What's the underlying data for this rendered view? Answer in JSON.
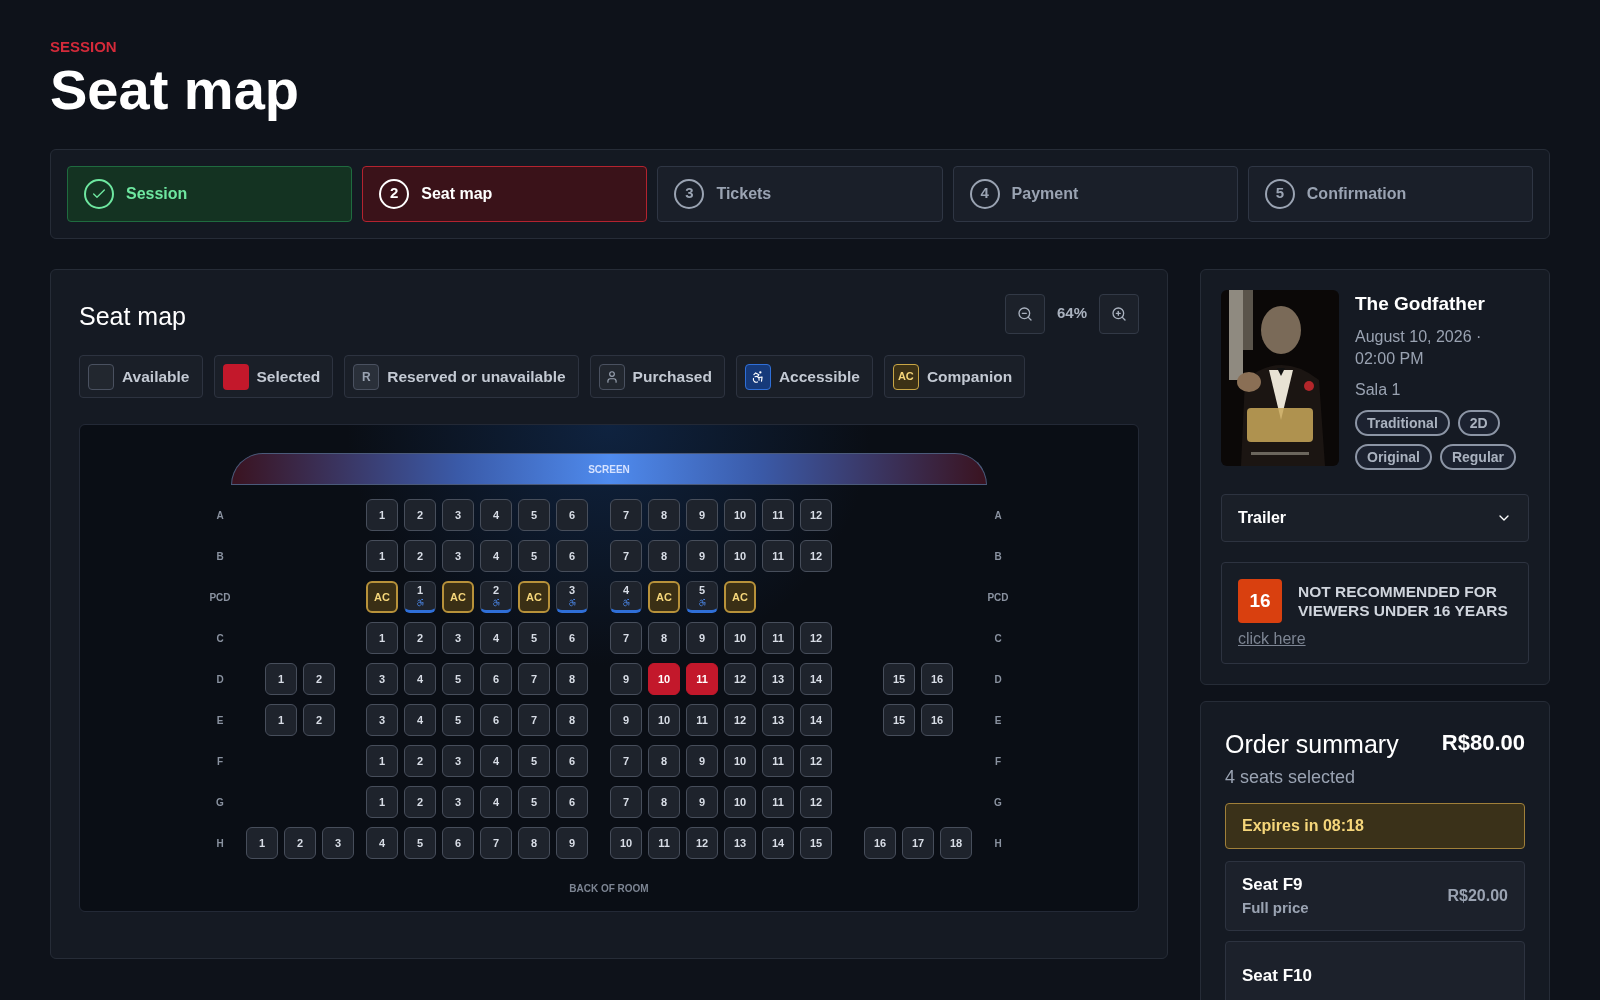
{
  "header": {
    "eyebrow": "SESSION",
    "title": "Seat map"
  },
  "steps": [
    {
      "label": "Session",
      "done": true,
      "selected": false
    },
    {
      "number": "2",
      "label": "Seat map",
      "done": false,
      "selected": true
    },
    {
      "number": "3",
      "label": "Tickets",
      "done": false,
      "selected": false
    },
    {
      "number": "4",
      "label": "Payment",
      "done": false,
      "selected": false
    },
    {
      "number": "5",
      "label": "Confirmation",
      "done": false,
      "selected": false
    }
  ],
  "seat_map": {
    "title": "Seat map",
    "zoom": "64%",
    "legend": [
      {
        "kind": "available",
        "label": "Available"
      },
      {
        "kind": "selected",
        "label": "Selected"
      },
      {
        "kind": "reserved",
        "symbol": "R",
        "label": "Reserved or unavailable"
      },
      {
        "kind": "purchased",
        "label": "Purchased"
      },
      {
        "kind": "accessible",
        "label": "Accessible"
      },
      {
        "kind": "companion",
        "symbol": "AC",
        "label": "Companion"
      }
    ],
    "screen_label": "SCREEN",
    "back_label": "BACK OF ROOM",
    "rows": [
      {
        "label_left": "A",
        "label_right": "A",
        "center_left": [
          {
            "label": "1",
            "kind": "standard",
            "selected": false
          },
          {
            "label": "2",
            "kind": "standard",
            "selected": false
          },
          {
            "label": "3",
            "kind": "standard",
            "selected": false
          },
          {
            "label": "4",
            "kind": "standard",
            "selected": false
          },
          {
            "label": "5",
            "kind": "standard",
            "selected": false
          },
          {
            "label": "6",
            "kind": "standard",
            "selected": false
          }
        ],
        "center_right": [
          {
            "label": "7",
            "kind": "standard",
            "selected": false
          },
          {
            "label": "8",
            "kind": "standard",
            "selected": false
          },
          {
            "label": "9",
            "kind": "standard",
            "selected": false
          },
          {
            "label": "10",
            "kind": "standard",
            "selected": false
          },
          {
            "label": "11",
            "kind": "standard",
            "selected": false
          },
          {
            "label": "12",
            "kind": "standard",
            "selected": false
          }
        ]
      },
      {
        "label_left": "B",
        "label_right": "B",
        "center_left": [
          {
            "label": "1",
            "kind": "standard",
            "selected": false
          },
          {
            "label": "2",
            "kind": "standard",
            "selected": false
          },
          {
            "label": "3",
            "kind": "standard",
            "selected": false
          },
          {
            "label": "4",
            "kind": "standard",
            "selected": false
          },
          {
            "label": "5",
            "kind": "standard",
            "selected": false
          },
          {
            "label": "6",
            "kind": "standard",
            "selected": false
          }
        ],
        "center_right": [
          {
            "label": "7",
            "kind": "standard",
            "selected": false
          },
          {
            "label": "8",
            "kind": "standard",
            "selected": false
          },
          {
            "label": "9",
            "kind": "standard",
            "selected": false
          },
          {
            "label": "10",
            "kind": "standard",
            "selected": false
          },
          {
            "label": "11",
            "kind": "standard",
            "selected": false
          },
          {
            "label": "12",
            "kind": "standard",
            "selected": false
          }
        ]
      },
      {
        "label_left": "PCD",
        "label_right": "PCD",
        "center_left": [
          {
            "label": "AC",
            "kind": "companion",
            "selected": false
          },
          {
            "label": "1",
            "kind": "accessible",
            "selected": false
          },
          {
            "label": "AC",
            "kind": "companion",
            "selected": false
          },
          {
            "label": "2",
            "kind": "accessible",
            "selected": false
          },
          {
            "label": "AC",
            "kind": "companion",
            "selected": false
          },
          {
            "label": "3",
            "kind": "accessible",
            "selected": false
          }
        ],
        "center_right": [
          {
            "label": "4",
            "kind": "accessible",
            "selected": false
          },
          {
            "label": "AC",
            "kind": "companion",
            "selected": false
          },
          {
            "label": "5",
            "kind": "accessible",
            "selected": false
          },
          {
            "label": "AC",
            "kind": "companion",
            "selected": false
          }
        ]
      },
      {
        "label_left": "C",
        "label_right": "C",
        "center_left": [
          {
            "label": "1",
            "kind": "standard",
            "selected": false
          },
          {
            "label": "2",
            "kind": "standard",
            "selected": false
          },
          {
            "label": "3",
            "kind": "standard",
            "selected": false
          },
          {
            "label": "4",
            "kind": "standard",
            "selected": false
          },
          {
            "label": "5",
            "kind": "standard",
            "selected": false
          },
          {
            "label": "6",
            "kind": "standard",
            "selected": false
          }
        ],
        "center_right": [
          {
            "label": "7",
            "kind": "standard",
            "selected": false
          },
          {
            "label": "8",
            "kind": "standard",
            "selected": false
          },
          {
            "label": "9",
            "kind": "standard",
            "selected": false
          },
          {
            "label": "10",
            "kind": "standard",
            "selected": false
          },
          {
            "label": "11",
            "kind": "standard",
            "selected": false
          },
          {
            "label": "12",
            "kind": "standard",
            "selected": false
          }
        ]
      },
      {
        "label_left": "D",
        "label_right": "D",
        "left": [
          {
            "label": "1",
            "kind": "standard",
            "selected": false
          },
          {
            "label": "2",
            "kind": "standard",
            "selected": false
          }
        ],
        "center_left": [
          {
            "label": "3",
            "kind": "standard",
            "selected": false
          },
          {
            "label": "4",
            "kind": "standard",
            "selected": false
          },
          {
            "label": "5",
            "kind": "standard",
            "selected": false
          },
          {
            "label": "6",
            "kind": "standard",
            "selected": false
          },
          {
            "label": "7",
            "kind": "standard",
            "selected": false
          },
          {
            "label": "8",
            "kind": "standard",
            "selected": false
          }
        ],
        "center_right": [
          {
            "label": "9",
            "kind": "standard",
            "selected": false
          },
          {
            "label": "10",
            "kind": "standard",
            "selected": true
          },
          {
            "label": "11",
            "kind": "standard",
            "selected": true
          },
          {
            "label": "12",
            "kind": "standard",
            "selected": false
          },
          {
            "label": "13",
            "kind": "standard",
            "selected": false
          },
          {
            "label": "14",
            "kind": "standard",
            "selected": false
          }
        ],
        "right": [
          {
            "label": "15",
            "kind": "standard",
            "selected": false
          },
          {
            "label": "16",
            "kind": "standard",
            "selected": false
          }
        ]
      },
      {
        "label_left": "E",
        "label_right": "E",
        "left": [
          {
            "label": "1",
            "kind": "standard",
            "selected": false
          },
          {
            "label": "2",
            "kind": "standard",
            "selected": false
          }
        ],
        "center_left": [
          {
            "label": "3",
            "kind": "standard",
            "selected": false
          },
          {
            "label": "4",
            "kind": "standard",
            "selected": false
          },
          {
            "label": "5",
            "kind": "standard",
            "selected": false
          },
          {
            "label": "6",
            "kind": "standard",
            "selected": false
          },
          {
            "label": "7",
            "kind": "standard",
            "selected": false
          },
          {
            "label": "8",
            "kind": "standard",
            "selected": false
          }
        ],
        "center_right": [
          {
            "label": "9",
            "kind": "standard",
            "selected": false
          },
          {
            "label": "10",
            "kind": "standard",
            "selected": false
          },
          {
            "label": "11",
            "kind": "standard",
            "selected": false
          },
          {
            "label": "12",
            "kind": "standard",
            "selected": false
          },
          {
            "label": "13",
            "kind": "standard",
            "selected": false
          },
          {
            "label": "14",
            "kind": "standard",
            "selected": false
          }
        ],
        "right": [
          {
            "label": "15",
            "kind": "standard",
            "selected": false
          },
          {
            "label": "16",
            "kind": "standard",
            "selected": false
          }
        ]
      },
      {
        "label_left": "F",
        "label_right": "F",
        "center_left": [
          {
            "label": "1",
            "kind": "standard",
            "selected": false
          },
          {
            "label": "2",
            "kind": "standard",
            "selected": false
          },
          {
            "label": "3",
            "kind": "standard",
            "selected": false
          },
          {
            "label": "4",
            "kind": "standard",
            "selected": false
          },
          {
            "label": "5",
            "kind": "standard",
            "selected": false
          },
          {
            "label": "6",
            "kind": "standard",
            "selected": false
          }
        ],
        "center_right": [
          {
            "label": "7",
            "kind": "standard",
            "selected": false
          },
          {
            "label": "8",
            "kind": "standard",
            "selected": false
          },
          {
            "label": "9",
            "kind": "standard",
            "selected": false
          },
          {
            "label": "10",
            "kind": "standard",
            "selected": false
          },
          {
            "label": "11",
            "kind": "standard",
            "selected": false
          },
          {
            "label": "12",
            "kind": "standard",
            "selected": false
          }
        ]
      },
      {
        "label_left": "G",
        "label_right": "G",
        "center_left": [
          {
            "label": "1",
            "kind": "standard",
            "selected": false
          },
          {
            "label": "2",
            "kind": "standard",
            "selected": false
          },
          {
            "label": "3",
            "kind": "standard",
            "selected": false
          },
          {
            "label": "4",
            "kind": "standard",
            "selected": false
          },
          {
            "label": "5",
            "kind": "standard",
            "selected": false
          },
          {
            "label": "6",
            "kind": "standard",
            "selected": false
          }
        ],
        "center_right": [
          {
            "label": "7",
            "kind": "standard",
            "selected": false
          },
          {
            "label": "8",
            "kind": "standard",
            "selected": false
          },
          {
            "label": "9",
            "kind": "standard",
            "selected": false
          },
          {
            "label": "10",
            "kind": "standard",
            "selected": false
          },
          {
            "label": "11",
            "kind": "standard",
            "selected": false
          },
          {
            "label": "12",
            "kind": "standard",
            "selected": false
          }
        ]
      },
      {
        "label_left": "H",
        "label_right": "H",
        "left": [
          {
            "label": "1",
            "kind": "standard",
            "selected": false
          },
          {
            "label": "2",
            "kind": "standard",
            "selected": false
          },
          {
            "label": "3",
            "kind": "standard",
            "selected": false
          }
        ],
        "center_left": [
          {
            "label": "4",
            "kind": "standard",
            "selected": false
          },
          {
            "label": "5",
            "kind": "standard",
            "selected": false
          },
          {
            "label": "6",
            "kind": "standard",
            "selected": false
          },
          {
            "label": "7",
            "kind": "standard",
            "selected": false
          },
          {
            "label": "8",
            "kind": "standard",
            "selected": false
          },
          {
            "label": "9",
            "kind": "standard",
            "selected": false
          }
        ],
        "center_right": [
          {
            "label": "10",
            "kind": "standard",
            "selected": false
          },
          {
            "label": "11",
            "kind": "standard",
            "selected": false
          },
          {
            "label": "12",
            "kind": "standard",
            "selected": false
          },
          {
            "label": "13",
            "kind": "standard",
            "selected": false
          },
          {
            "label": "14",
            "kind": "standard",
            "selected": false
          },
          {
            "label": "15",
            "kind": "standard",
            "selected": false
          }
        ],
        "right": [
          {
            "label": "16",
            "kind": "standard",
            "selected": false
          },
          {
            "label": "17",
            "kind": "standard",
            "selected": false
          },
          {
            "label": "18",
            "kind": "standard",
            "selected": false
          }
        ]
      }
    ]
  },
  "movie": {
    "title": "The Godfather",
    "datetime": "August 10, 2026 · 02:00 PM",
    "room": "Sala 1",
    "tags": [
      "Traditional",
      "2D",
      "Original",
      "Regular"
    ],
    "trailer": {
      "label": "Trailer",
      "expanded": false
    },
    "rating": {
      "age": "16",
      "text": "NOT RECOMMENDED FOR VIEWERS UNDER 16 YEARS",
      "link": "click here"
    }
  },
  "order": {
    "title": "Order summary",
    "total": "R$80.00",
    "subtitle": "4 seats selected",
    "expires": "Expires in 08:18",
    "items": [
      {
        "seat": "Seat F9",
        "type": "Full price",
        "price": "R$20.00"
      },
      {
        "seat": "Seat F10"
      }
    ]
  }
}
